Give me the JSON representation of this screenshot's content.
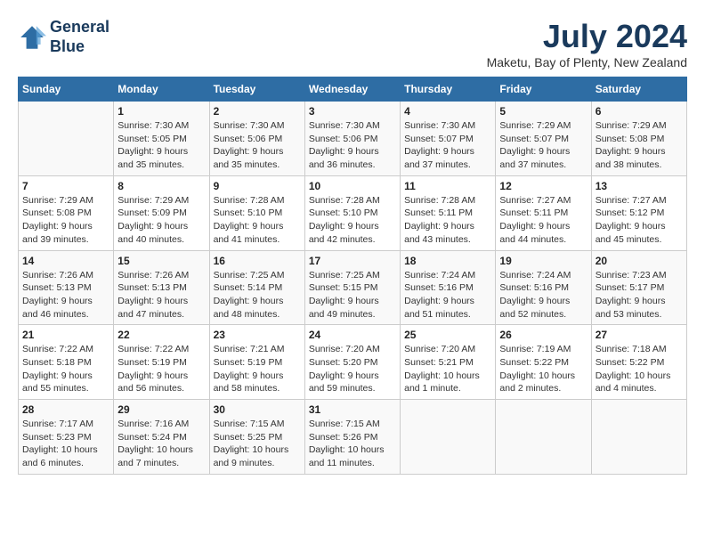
{
  "header": {
    "logo_line1": "General",
    "logo_line2": "Blue",
    "month_year": "July 2024",
    "location": "Maketu, Bay of Plenty, New Zealand"
  },
  "days_of_week": [
    "Sunday",
    "Monday",
    "Tuesday",
    "Wednesday",
    "Thursday",
    "Friday",
    "Saturday"
  ],
  "weeks": [
    [
      {
        "num": "",
        "info": ""
      },
      {
        "num": "1",
        "info": "Sunrise: 7:30 AM\nSunset: 5:05 PM\nDaylight: 9 hours\nand 35 minutes."
      },
      {
        "num": "2",
        "info": "Sunrise: 7:30 AM\nSunset: 5:06 PM\nDaylight: 9 hours\nand 35 minutes."
      },
      {
        "num": "3",
        "info": "Sunrise: 7:30 AM\nSunset: 5:06 PM\nDaylight: 9 hours\nand 36 minutes."
      },
      {
        "num": "4",
        "info": "Sunrise: 7:30 AM\nSunset: 5:07 PM\nDaylight: 9 hours\nand 37 minutes."
      },
      {
        "num": "5",
        "info": "Sunrise: 7:29 AM\nSunset: 5:07 PM\nDaylight: 9 hours\nand 37 minutes."
      },
      {
        "num": "6",
        "info": "Sunrise: 7:29 AM\nSunset: 5:08 PM\nDaylight: 9 hours\nand 38 minutes."
      }
    ],
    [
      {
        "num": "7",
        "info": "Sunrise: 7:29 AM\nSunset: 5:08 PM\nDaylight: 9 hours\nand 39 minutes."
      },
      {
        "num": "8",
        "info": "Sunrise: 7:29 AM\nSunset: 5:09 PM\nDaylight: 9 hours\nand 40 minutes."
      },
      {
        "num": "9",
        "info": "Sunrise: 7:28 AM\nSunset: 5:10 PM\nDaylight: 9 hours\nand 41 minutes."
      },
      {
        "num": "10",
        "info": "Sunrise: 7:28 AM\nSunset: 5:10 PM\nDaylight: 9 hours\nand 42 minutes."
      },
      {
        "num": "11",
        "info": "Sunrise: 7:28 AM\nSunset: 5:11 PM\nDaylight: 9 hours\nand 43 minutes."
      },
      {
        "num": "12",
        "info": "Sunrise: 7:27 AM\nSunset: 5:11 PM\nDaylight: 9 hours\nand 44 minutes."
      },
      {
        "num": "13",
        "info": "Sunrise: 7:27 AM\nSunset: 5:12 PM\nDaylight: 9 hours\nand 45 minutes."
      }
    ],
    [
      {
        "num": "14",
        "info": "Sunrise: 7:26 AM\nSunset: 5:13 PM\nDaylight: 9 hours\nand 46 minutes."
      },
      {
        "num": "15",
        "info": "Sunrise: 7:26 AM\nSunset: 5:13 PM\nDaylight: 9 hours\nand 47 minutes."
      },
      {
        "num": "16",
        "info": "Sunrise: 7:25 AM\nSunset: 5:14 PM\nDaylight: 9 hours\nand 48 minutes."
      },
      {
        "num": "17",
        "info": "Sunrise: 7:25 AM\nSunset: 5:15 PM\nDaylight: 9 hours\nand 49 minutes."
      },
      {
        "num": "18",
        "info": "Sunrise: 7:24 AM\nSunset: 5:16 PM\nDaylight: 9 hours\nand 51 minutes."
      },
      {
        "num": "19",
        "info": "Sunrise: 7:24 AM\nSunset: 5:16 PM\nDaylight: 9 hours\nand 52 minutes."
      },
      {
        "num": "20",
        "info": "Sunrise: 7:23 AM\nSunset: 5:17 PM\nDaylight: 9 hours\nand 53 minutes."
      }
    ],
    [
      {
        "num": "21",
        "info": "Sunrise: 7:22 AM\nSunset: 5:18 PM\nDaylight: 9 hours\nand 55 minutes."
      },
      {
        "num": "22",
        "info": "Sunrise: 7:22 AM\nSunset: 5:19 PM\nDaylight: 9 hours\nand 56 minutes."
      },
      {
        "num": "23",
        "info": "Sunrise: 7:21 AM\nSunset: 5:19 PM\nDaylight: 9 hours\nand 58 minutes."
      },
      {
        "num": "24",
        "info": "Sunrise: 7:20 AM\nSunset: 5:20 PM\nDaylight: 9 hours\nand 59 minutes."
      },
      {
        "num": "25",
        "info": "Sunrise: 7:20 AM\nSunset: 5:21 PM\nDaylight: 10 hours\nand 1 minute."
      },
      {
        "num": "26",
        "info": "Sunrise: 7:19 AM\nSunset: 5:22 PM\nDaylight: 10 hours\nand 2 minutes."
      },
      {
        "num": "27",
        "info": "Sunrise: 7:18 AM\nSunset: 5:22 PM\nDaylight: 10 hours\nand 4 minutes."
      }
    ],
    [
      {
        "num": "28",
        "info": "Sunrise: 7:17 AM\nSunset: 5:23 PM\nDaylight: 10 hours\nand 6 minutes."
      },
      {
        "num": "29",
        "info": "Sunrise: 7:16 AM\nSunset: 5:24 PM\nDaylight: 10 hours\nand 7 minutes."
      },
      {
        "num": "30",
        "info": "Sunrise: 7:15 AM\nSunset: 5:25 PM\nDaylight: 10 hours\nand 9 minutes."
      },
      {
        "num": "31",
        "info": "Sunrise: 7:15 AM\nSunset: 5:26 PM\nDaylight: 10 hours\nand 11 minutes."
      },
      {
        "num": "",
        "info": ""
      },
      {
        "num": "",
        "info": ""
      },
      {
        "num": "",
        "info": ""
      }
    ]
  ]
}
